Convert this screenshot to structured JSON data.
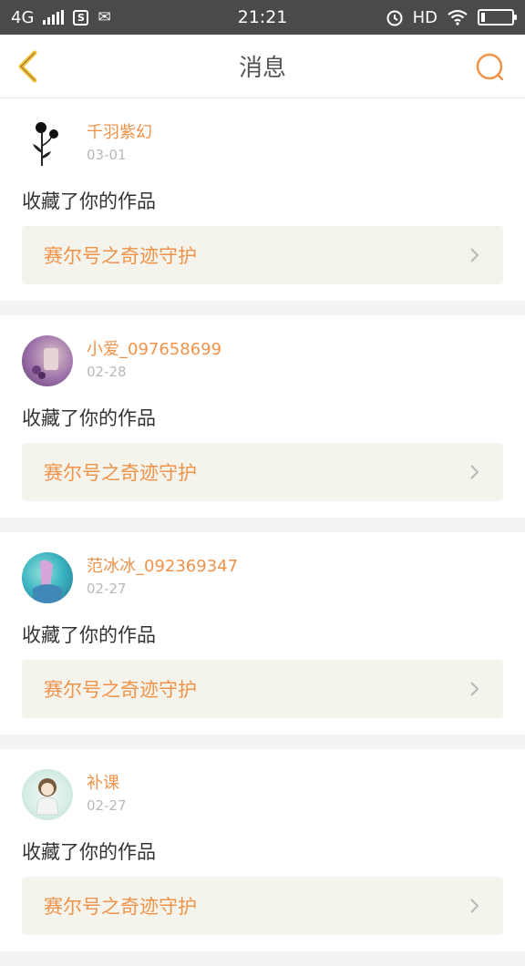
{
  "status_bar": {
    "network": "4G",
    "time": "21:21",
    "hd": "HD"
  },
  "header": {
    "title": "消息"
  },
  "messages": [
    {
      "user": "千羽紫幻",
      "date": "03-01",
      "action": "收藏了你的作品",
      "work": "赛尔号之奇迹守护"
    },
    {
      "user": "小爱_097658699",
      "date": "02-28",
      "action": "收藏了你的作品",
      "work": "赛尔号之奇迹守护"
    },
    {
      "user": "范冰冰_092369347",
      "date": "02-27",
      "action": "收藏了你的作品",
      "work": "赛尔号之奇迹守护"
    },
    {
      "user": "补课",
      "date": "02-27",
      "action": "收藏了你的作品",
      "work": "赛尔号之奇迹守护"
    }
  ],
  "colors": {
    "accent": "#f0934a",
    "back_arrow": "#f5c33b",
    "work_box_bg": "#f4f4ec"
  }
}
